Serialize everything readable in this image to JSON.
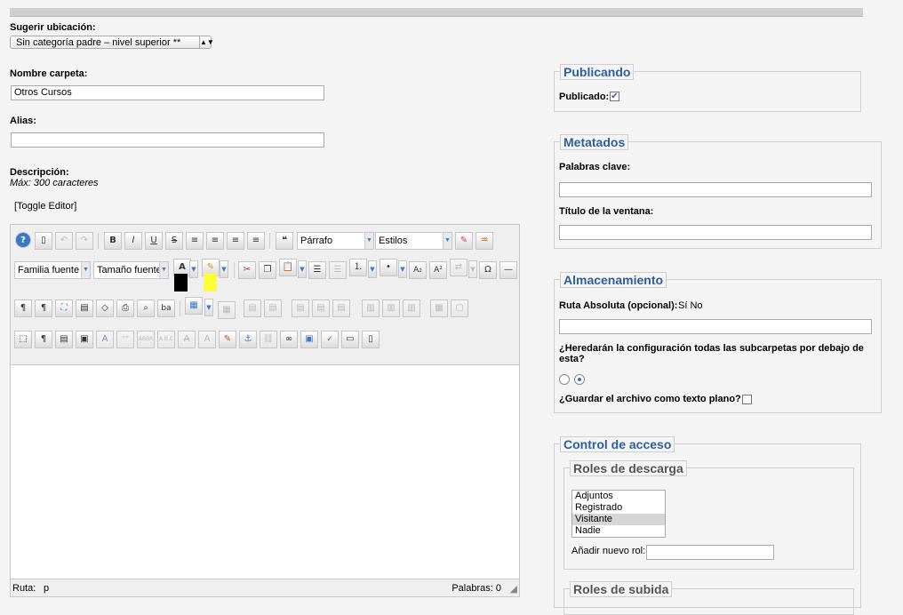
{
  "form": {
    "suggest_label": "Sugerir ubicación:",
    "suggest_value": "Sin categoría padre – nivel superior **",
    "name_label": "Nombre carpeta:",
    "name_value": "Otros Cursos",
    "alias_label": "Alias:",
    "alias_value": "",
    "desc_label": "Descripción:",
    "desc_note": "Máx: 300 caracteres",
    "toggle_editor": "[Toggle Editor]"
  },
  "editor": {
    "format_select": "Párrafo",
    "styles_select": "Estilos",
    "font_family": "Familia fuente",
    "font_size": "Tamaño fuente",
    "text_color": "#000000",
    "highlight_color": "#ffff33",
    "path_label": "Ruta:",
    "path_value": "p",
    "words_label": "Palabras: 0"
  },
  "publishing": {
    "legend": "Publicando",
    "published_label": "Publicado:",
    "published_checked": true
  },
  "metadata": {
    "legend": "Metatados",
    "keywords_label": "Palabras clave:",
    "window_title_label": "Título de la ventana:"
  },
  "storage": {
    "legend": "Almacenamiento",
    "absolute_path_label": "Ruta Absoluta (opcional):",
    "yes_no": "Sí No",
    "inherit_label": "¿Heredarán la configuración todas las subcarpetas por debajo de esta?",
    "plain_text_label": "¿Guardar el archivo como texto plano?"
  },
  "access": {
    "legend": "Control de acceso",
    "download_roles_legend": "Roles de descarga",
    "roles": [
      "Adjuntos",
      "Registrado",
      "Visitante",
      "Nadie"
    ],
    "selected_role": "Visitante",
    "add_role_label": "Añadir nuevo rol:",
    "upload_roles_legend": "Roles de subida"
  }
}
